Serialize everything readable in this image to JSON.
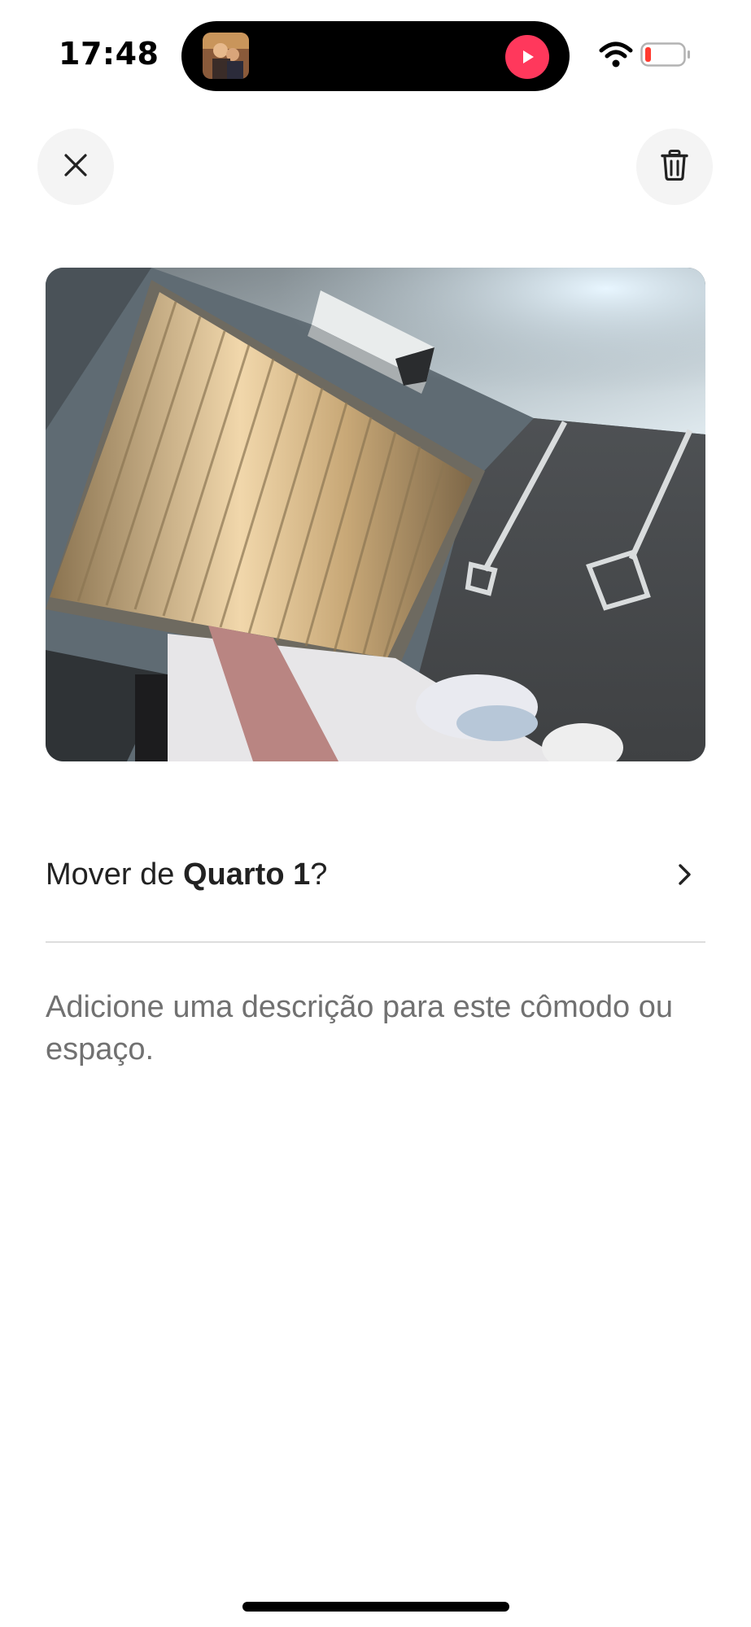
{
  "status_bar": {
    "time": "17:48",
    "wifi_icon": "wifi-icon",
    "battery_icon": "battery-low-icon",
    "battery_level": 0.12
  },
  "live_activity": {
    "artwork_icon": "album-art",
    "play_icon": "play-icon",
    "accent_color": "#ff385c"
  },
  "toolbar": {
    "close_icon": "close-icon",
    "delete_icon": "trash-icon"
  },
  "photo": {
    "icon": "room-photo"
  },
  "move_row": {
    "prefix": "Mover de ",
    "room": "Quarto 1",
    "suffix": "?",
    "chevron_icon": "chevron-right-icon"
  },
  "description": {
    "placeholder": "Adicione uma descrição para este cômodo ou espaço."
  },
  "colors": {
    "text_primary": "#222222",
    "text_secondary": "#717171",
    "divider": "#dddddd",
    "button_bg": "#f4f4f4"
  }
}
